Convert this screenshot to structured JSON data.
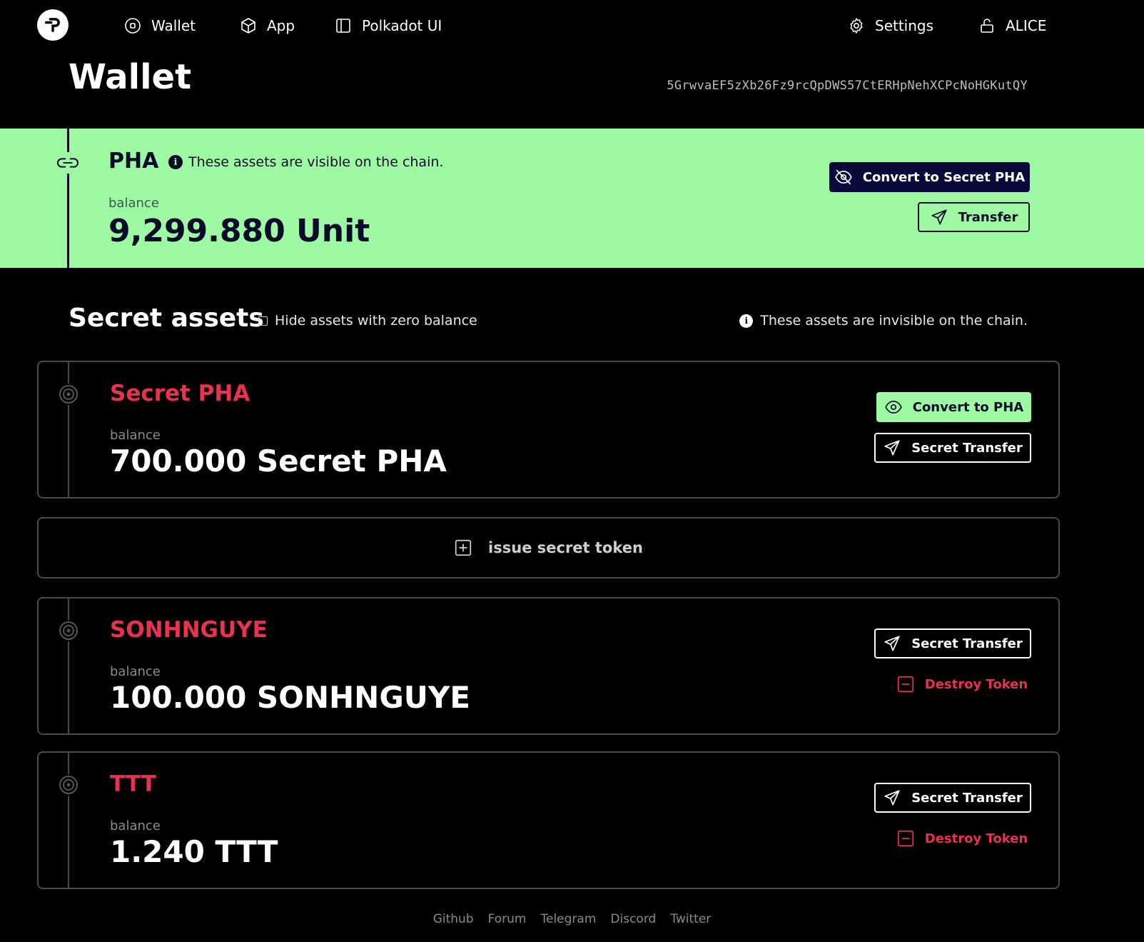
{
  "nav": {
    "items": [
      {
        "label": "Wallet",
        "icon": "wallet-icon"
      },
      {
        "label": "App",
        "icon": "cube-icon"
      },
      {
        "label": "Polkadot UI",
        "icon": "sidebar-icon"
      }
    ],
    "settings_label": "Settings",
    "account_label": "ALICE"
  },
  "header": {
    "title": "Wallet",
    "address": "5GrwvaEF5zXb26Fz9rcQpDWS57CtERHpNehXCPcNoHGKutQY"
  },
  "pha": {
    "name": "PHA",
    "note": "These assets are visible on the chain.",
    "balance_label": "balance",
    "balance": "9,299.880 Unit",
    "convert_label": "Convert to Secret PHA",
    "transfer_label": "Transfer",
    "bg_color": "#9ef9a3"
  },
  "secret": {
    "title": "Secret assets",
    "hide_label": "Hide assets with zero balance",
    "note": "These assets are invisible on the chain.",
    "issue_label": "issue secret token",
    "assets": [
      {
        "name": "Secret PHA",
        "balance_label": "balance",
        "balance": "700.000 Secret PHA",
        "primary_label": "Convert to PHA",
        "secondary_label": "Secret Transfer"
      },
      {
        "name": "SONHNGUYE",
        "balance_label": "balance",
        "balance": "100.000 SONHNGUYE",
        "primary_label": "Secret Transfer",
        "secondary_label": "Destroy Token"
      },
      {
        "name": "TTT",
        "balance_label": "balance",
        "balance": "1.240 TTT",
        "primary_label": "Secret Transfer",
        "secondary_label": "Destroy Token"
      }
    ],
    "accent_color": "#e8324f"
  },
  "footer": {
    "links": [
      "Github",
      "Forum",
      "Telegram",
      "Discord",
      "Twitter"
    ]
  }
}
